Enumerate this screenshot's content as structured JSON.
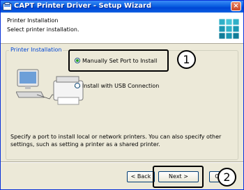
{
  "window": {
    "title": "CAPT Printer Driver - Setup Wizard",
    "close_glyph": "×"
  },
  "header": {
    "title": "Printer Installation",
    "subtitle": "Select printer installation."
  },
  "group": {
    "label": "Printer Installation",
    "options": [
      {
        "label": "Manually Set Port to Install",
        "selected": true
      },
      {
        "label": "Install with USB Connection",
        "selected": false
      }
    ]
  },
  "description": "Specify a port to install local or network printers. You can also specify other settings, such as setting a printer as a shared printer.",
  "buttons": {
    "back": "< Back",
    "next": "Next >",
    "cancel": "C"
  },
  "annotations": {
    "marker1": "1",
    "marker2": "2"
  },
  "colors": {
    "titlebar": "#0a5fe1",
    "dialog_bg": "#ece9d8",
    "group_label": "#0046d5"
  },
  "icons": [
    "setup-app-icon",
    "close-icon",
    "setup-cube-icon",
    "computer-printer-illustration",
    "radio-button"
  ]
}
